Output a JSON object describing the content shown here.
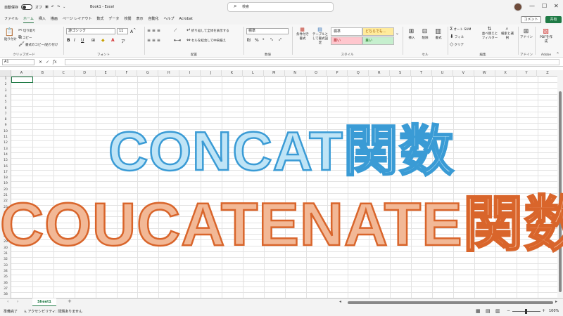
{
  "titlebar": {
    "autosave_label": "自動保存",
    "autosave_state": "オフ",
    "title": "Book1 - Excel",
    "search_placeholder": "検索"
  },
  "menu": {
    "tabs": [
      "ファイル",
      "ホーム",
      "挿入",
      "描画",
      "ページ レイアウト",
      "数式",
      "データ",
      "校閲",
      "表示",
      "自動化",
      "ヘルプ",
      "Acrobat"
    ],
    "active": "ホーム",
    "comment_label": "コメント",
    "share_label": "共有"
  },
  "ribbon": {
    "clipboard": {
      "paste": "貼り付け",
      "cut": "切り取り",
      "copy": "コピー",
      "format_painter": "書式のコピー/貼り付け",
      "label": "クリップボード"
    },
    "font": {
      "name": "游ゴシック",
      "size": "11",
      "label": "フォント",
      "bold": "B",
      "italic": "I",
      "underline": "U"
    },
    "alignment": {
      "wrap": "折り返して全体を表示する",
      "merge": "セルを結合して中央揃え",
      "label": "配置"
    },
    "number": {
      "format": "標準",
      "label": "数値"
    },
    "styles": {
      "conditional": "条件付き書式",
      "table": "テーブルとして書式設定",
      "normal": "標準",
      "neutral": "どちらでも...",
      "bad": "悪い",
      "good": "良い",
      "label": "スタイル"
    },
    "cells": {
      "insert": "挿入",
      "delete": "削除",
      "format": "書式",
      "label": "セル"
    },
    "editing": {
      "autosum": "オート SUM",
      "fill": "フィル",
      "clear": "クリア",
      "sort": "並べ替えとフィルター",
      "find": "検索と選択",
      "label": "編集"
    },
    "addins": {
      "label": "アドイン",
      "button": "アドイン"
    },
    "adobe": {
      "label": "Adobe",
      "button": "PDFを作成"
    }
  },
  "formula_bar": {
    "name_box": "A1",
    "fx": "fx",
    "value": ""
  },
  "grid": {
    "columns": [
      "A",
      "B",
      "C",
      "D",
      "E",
      "F",
      "G",
      "H",
      "I",
      "J",
      "K",
      "L",
      "M",
      "N",
      "O",
      "P",
      "Q",
      "R",
      "S",
      "T",
      "U",
      "V",
      "W",
      "X",
      "Y",
      "Z"
    ],
    "rows": [
      "1",
      "2",
      "3",
      "4",
      "5",
      "6",
      "7",
      "8",
      "9",
      "10",
      "11",
      "12",
      "13",
      "14",
      "15",
      "16",
      "17",
      "18",
      "19",
      "20",
      "21",
      "22",
      "23",
      "24",
      "25",
      "26",
      "27",
      "28",
      "29",
      "30",
      "31",
      "32",
      "33",
      "34",
      "35",
      "36",
      "37",
      "38"
    ]
  },
  "overlay": {
    "line1": "CONCAT関数",
    "line2": "COUCATENATE関数",
    "color1_fill": "#bfe4f6",
    "color1_stroke": "#3a9bd5",
    "color2_fill": "#f2b896",
    "color2_stroke": "#d9652b"
  },
  "sheets": {
    "tabs": [
      "Sheet1"
    ],
    "add": "+"
  },
  "status": {
    "ready": "準備完了",
    "accessibility": "アクセシビリティ: 問題ありません",
    "zoom": "100%"
  },
  "accent": "#1f7a45"
}
